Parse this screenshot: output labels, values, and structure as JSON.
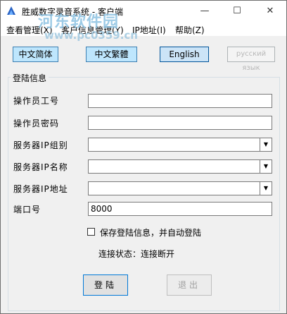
{
  "window": {
    "title": "胜威数字录音系统 - 客户端",
    "minimize": "—",
    "maximize": "☐",
    "close": "✕",
    "icon": "app-recorder-icon"
  },
  "watermark": {
    "line1": "河东软件园",
    "line2": "www.pc0359.cn"
  },
  "menu": [
    {
      "label": "查看管理(X)"
    },
    {
      "label": "客户信息管理(Y)"
    },
    {
      "label": "IP地址(I)"
    },
    {
      "label": "帮助(Z)"
    }
  ],
  "languages": {
    "simplified": "中文简体",
    "traditional": "中文繁體",
    "english": "English",
    "russian": "русский язык"
  },
  "login": {
    "group_title": "登陆信息",
    "operator_id_label": "操作员工号",
    "operator_id_value": "",
    "password_label": "操作员密码",
    "password_value": "",
    "server_group_label": "服务器IP组别",
    "server_group_value": "",
    "server_name_label": "服务器IP名称",
    "server_name_value": "",
    "server_addr_label": "服务器IP地址",
    "server_addr_value": "",
    "port_label": "端口号",
    "port_value": "8000",
    "save_label": "保存登陆信息，并自动登陆",
    "status_text": "连接状态：连接断开",
    "login_button": "登陆",
    "exit_button": "退出"
  }
}
